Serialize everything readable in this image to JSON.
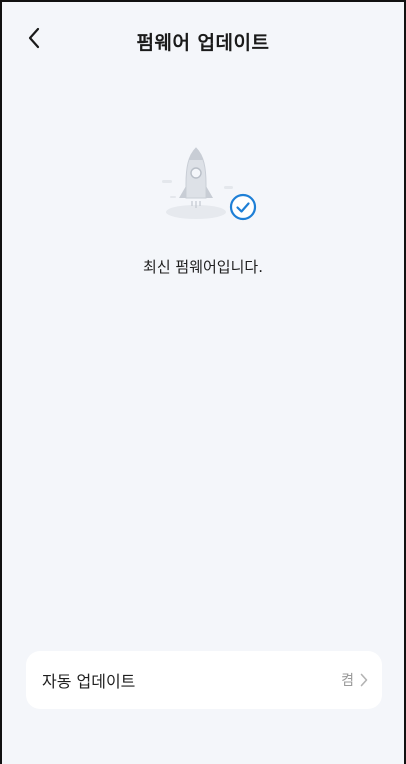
{
  "header": {
    "title": "펌웨어 업데이트"
  },
  "status": {
    "message": "최신 펌웨어입니다."
  },
  "settings": {
    "auto_update_label": "자동 업데이트",
    "auto_update_value": "켬"
  },
  "colors": {
    "accent": "#1e7fd6",
    "background": "#f4f6fa",
    "card": "#ffffff",
    "muted_text": "#9b9b9b"
  },
  "icons": {
    "back": "chevron-left-icon",
    "rocket": "rocket-icon",
    "check": "check-circle-icon",
    "chevron": "chevron-right-icon"
  }
}
